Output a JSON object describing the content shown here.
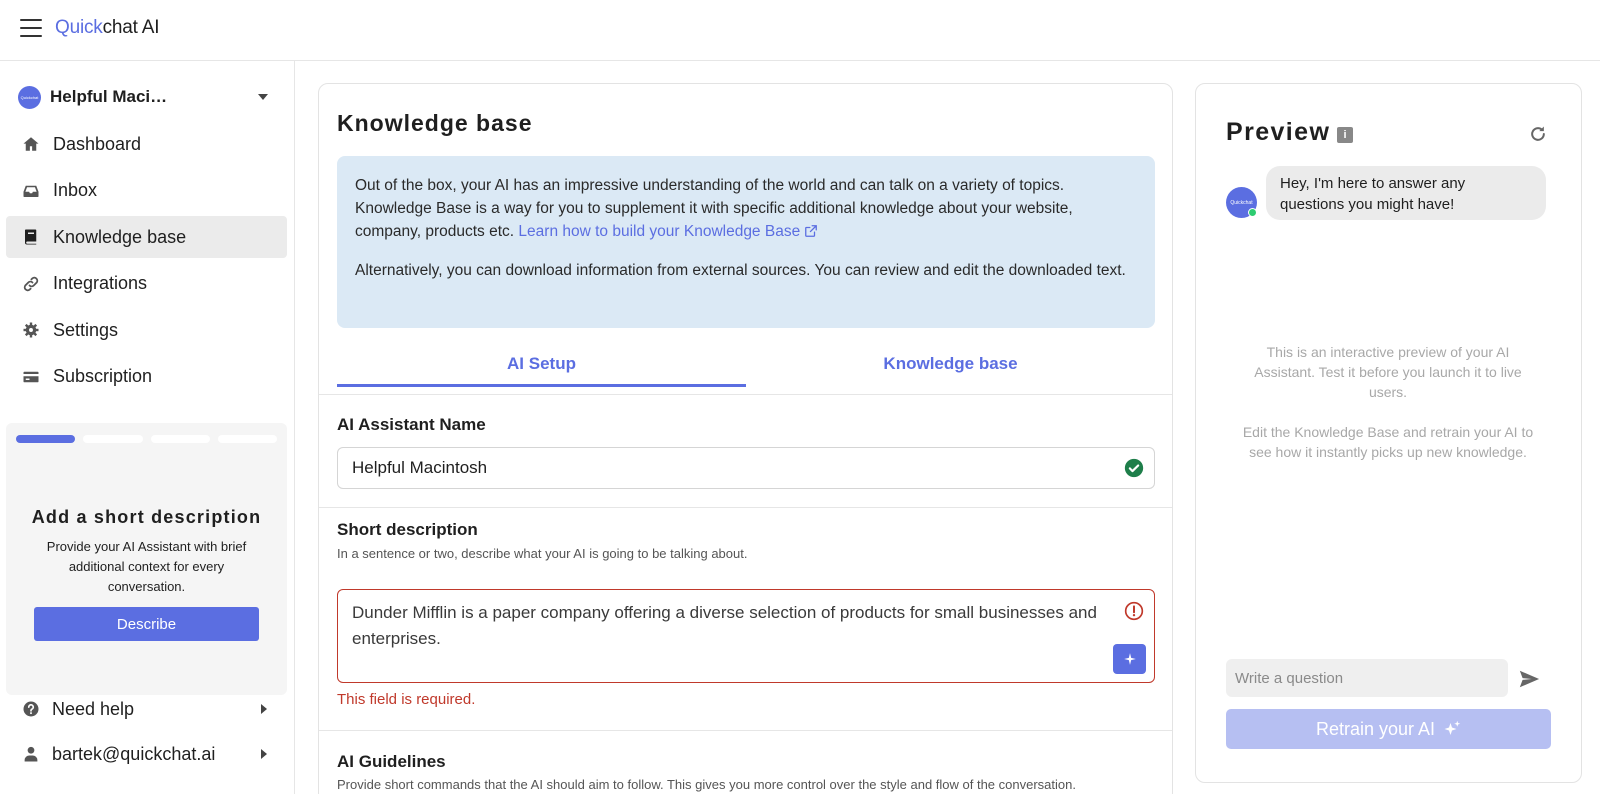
{
  "header": {
    "logo_quick": "Quick",
    "logo_chat": "chat AI"
  },
  "sidebar": {
    "assistant_name": "Helpful Maci…",
    "assistant_avatar_text": "Quickchat",
    "items": [
      {
        "label": "Dashboard",
        "icon": "home-icon"
      },
      {
        "label": "Inbox",
        "icon": "inbox-icon"
      },
      {
        "label": "Knowledge base",
        "icon": "book-icon",
        "active": true
      },
      {
        "label": "Integrations",
        "icon": "link-icon"
      },
      {
        "label": "Settings",
        "icon": "gear-icon"
      },
      {
        "label": "Subscription",
        "icon": "credit-card-icon"
      }
    ],
    "onboarding": {
      "steps_total": 4,
      "steps_done": 1,
      "title": "Add a short description",
      "text": "Provide your AI Assistant with brief additional context for every conversation.",
      "button_label": "Describe"
    },
    "need_help_label": "Need help",
    "user_email": "bartek@quickchat.ai"
  },
  "main": {
    "title": "Knowledge base",
    "info_p1": "Out of the box, your AI has an impressive understanding of the world and can talk on a variety of topics. Knowledge Base is a way for you to supplement it with specific additional knowledge about your website, company, products etc.",
    "info_link": "Learn how to build your Knowledge Base",
    "info_p2": "Alternatively, you can download information from external sources. You can review and edit the downloaded text.",
    "tabs": [
      {
        "label": "AI Setup",
        "active": true
      },
      {
        "label": "Knowledge base",
        "active": false
      }
    ],
    "name_label": "AI Assistant Name",
    "name_value": "Helpful Macintosh",
    "desc_label": "Short description",
    "desc_help": "In a sentence or two, describe what your AI is going to be talking about.",
    "desc_value": "Dunder Mifflin is a paper company offering a diverse selection of products for small businesses and enterprises.",
    "desc_error": "This field is required.",
    "guidelines_label": "AI Guidelines",
    "guidelines_help": "Provide short commands that the AI should aim to follow. This gives you more control over the style and flow of the conversation."
  },
  "preview": {
    "title": "Preview",
    "bot_avatar_text": "Quickchat",
    "greeting": "Hey, I'm here to answer any questions you might have!",
    "note1": "This is an interactive preview of your AI Assistant. Test it before you launch it to live users.",
    "note2": "Edit the Knowledge Base and retrain your AI to see how it instantly picks up new knowledge.",
    "question_placeholder": "Write a question",
    "retrain_label": "Retrain your AI"
  },
  "colors": {
    "accent": "#5b6ee1",
    "error": "#c0392b",
    "success": "#1e7e4a",
    "info_bg": "#dbe9f5"
  }
}
